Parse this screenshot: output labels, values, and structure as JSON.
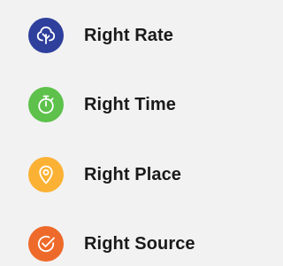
{
  "items": [
    {
      "label": "Right Rate",
      "icon": "tree-icon",
      "color": "#2e3f9c"
    },
    {
      "label": "Right Time",
      "icon": "stopwatch-icon",
      "color": "#5dc14b"
    },
    {
      "label": "Right Place",
      "icon": "location-pin-icon",
      "color": "#fbb133"
    },
    {
      "label": "Right Source",
      "icon": "check-circle-icon",
      "color": "#ee6a2a"
    }
  ]
}
